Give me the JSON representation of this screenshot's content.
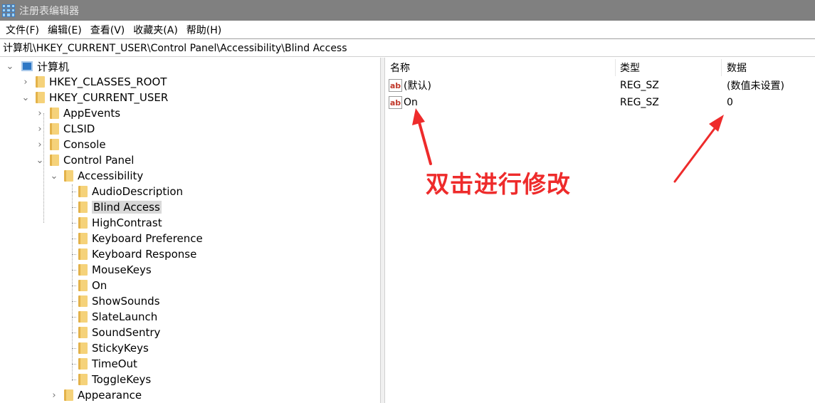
{
  "window": {
    "title": "注册表编辑器"
  },
  "menu": [
    "文件(F)",
    "编辑(E)",
    "查看(V)",
    "收藏夹(A)",
    "帮助(H)"
  ],
  "address": "计算机\\HKEY_CURRENT_USER\\Control Panel\\Accessibility\\Blind Access",
  "tree": {
    "root": "计算机",
    "hkcr": "HKEY_CLASSES_ROOT",
    "hkcu": "HKEY_CURRENT_USER",
    "appevents": "AppEvents",
    "clsid": "CLSID",
    "console": "Console",
    "control_panel": "Control Panel",
    "accessibility": "Accessibility",
    "children": [
      "AudioDescription",
      "Blind Access",
      "HighContrast",
      "Keyboard Preference",
      "Keyboard Response",
      "MouseKeys",
      "On",
      "ShowSounds",
      "SlateLaunch",
      "SoundSentry",
      "StickyKeys",
      "TimeOut",
      "ToggleKeys"
    ],
    "appearance": "Appearance"
  },
  "columns": {
    "name": "名称",
    "type": "类型",
    "data": "数据"
  },
  "values": [
    {
      "name": "(默认)",
      "type": "REG_SZ",
      "data": "(数值未设置)"
    },
    {
      "name": "On",
      "type": "REG_SZ",
      "data": "0"
    }
  ],
  "annotation": {
    "text": "双击进行修改",
    "color": "#ee2b2b"
  },
  "colors": {
    "titlebar": "#808080",
    "selection": "#d9d9d9",
    "folder": "#f5d27a"
  }
}
